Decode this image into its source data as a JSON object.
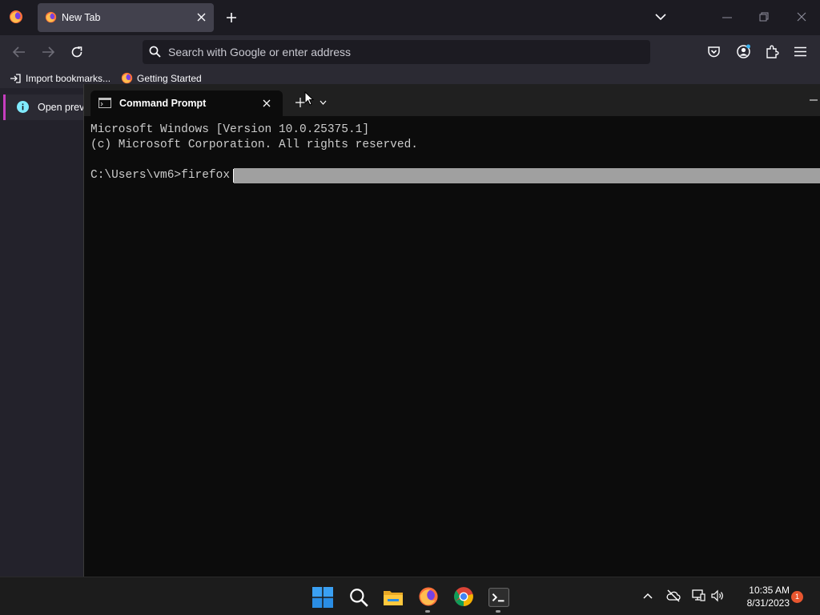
{
  "firefox": {
    "tab_title": "New Tab",
    "url_placeholder": "Search with Google or enter address",
    "bookmarks": [
      {
        "label": "Import bookmarks..."
      },
      {
        "label": "Getting Started"
      }
    ],
    "notification_text": "Open previ"
  },
  "terminal": {
    "tab_title": "Command Prompt",
    "lines": [
      "Microsoft Windows [Version 10.0.25375.1]",
      "(c) Microsoft Corporation. All rights reserved.",
      "",
      "C:\\Users\\vm6>firefox"
    ]
  },
  "taskbar": {
    "time": "10:35 AM",
    "date": "8/31/2023",
    "notification_count": "1"
  },
  "colors": {
    "firefox_dark": "#1c1b22",
    "firefox_toolbar": "#2b2a33",
    "terminal_bg": "#0c0c0c",
    "selection": "#a0a0a0",
    "notification_accent": "#c63dbf",
    "badge": "#e8562f"
  }
}
